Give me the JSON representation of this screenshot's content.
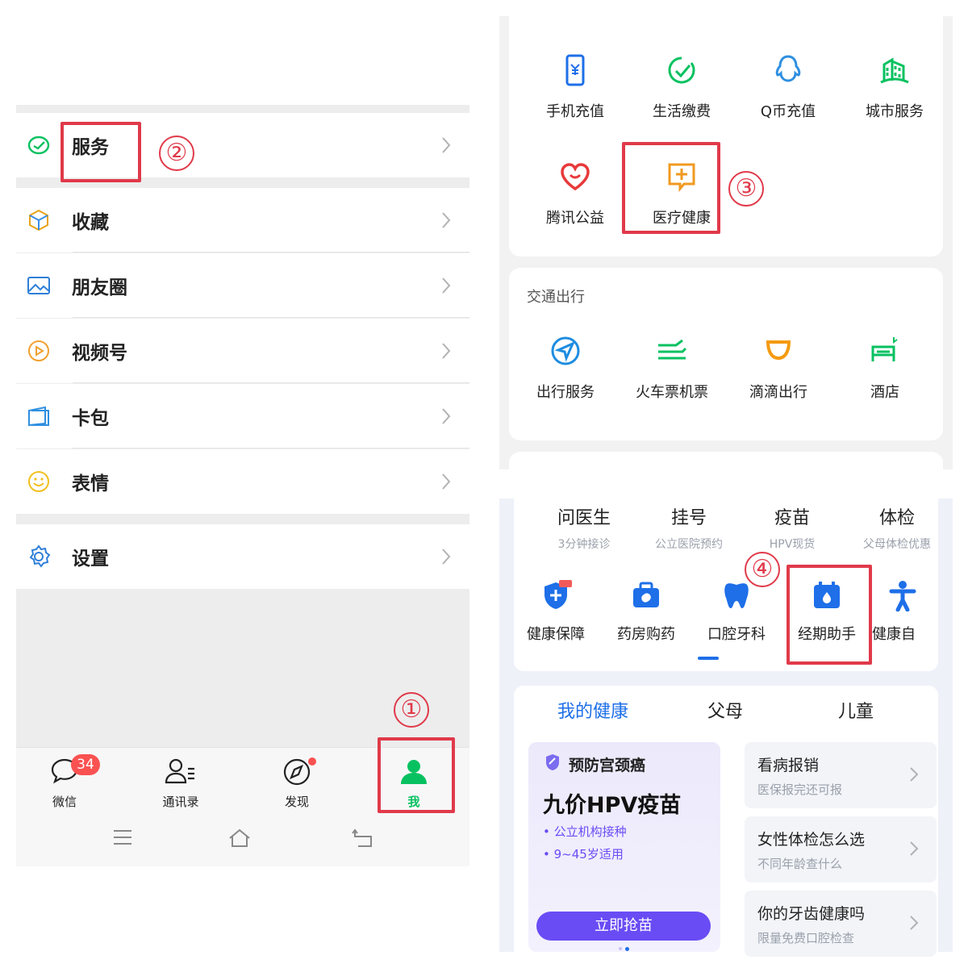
{
  "panelA": {
    "menu": [
      {
        "label": "服务",
        "icon": "service-icon"
      },
      {
        "label": "收藏",
        "icon": "favorites-icon"
      },
      {
        "label": "朋友圈",
        "icon": "moments-icon"
      },
      {
        "label": "视频号",
        "icon": "channels-icon"
      },
      {
        "label": "卡包",
        "icon": "card-wallet-icon"
      },
      {
        "label": "表情",
        "icon": "stickers-icon"
      },
      {
        "label": "设置",
        "icon": "settings-icon"
      }
    ],
    "tabbar": [
      {
        "label": "微信",
        "badge": "34"
      },
      {
        "label": "通讯录"
      },
      {
        "label": "发现"
      },
      {
        "label": "我"
      }
    ],
    "step1": "①",
    "step2": "②"
  },
  "panelB": {
    "services": [
      {
        "label": "手机充值",
        "icon": "phone-recharge-icon"
      },
      {
        "label": "生活缴费",
        "icon": "bill-pay-icon"
      },
      {
        "label": "Q币充值",
        "icon": "qcoin-icon"
      },
      {
        "label": "城市服务",
        "icon": "city-service-icon"
      },
      {
        "label": "腾讯公益",
        "icon": "charity-icon"
      },
      {
        "label": "医疗健康",
        "icon": "medical-icon"
      }
    ],
    "transport_title": "交通出行",
    "transport": [
      {
        "label": "出行服务",
        "icon": "travel-icon"
      },
      {
        "label": "火车票机票",
        "icon": "train-flight-icon"
      },
      {
        "label": "滴滴出行",
        "icon": "didi-icon"
      },
      {
        "label": "酒店",
        "icon": "hotel-icon"
      }
    ],
    "step3": "③"
  },
  "panelC": {
    "nav": [
      {
        "title": "问医生",
        "sub": "3分钟接诊"
      },
      {
        "title": "挂号",
        "sub": "公立医院预约"
      },
      {
        "title": "疫苗",
        "sub": "HPV现货"
      },
      {
        "title": "体检",
        "sub": "父母体检优惠"
      }
    ],
    "funcs": [
      {
        "label": "健康保障",
        "icon": "health-shield-icon"
      },
      {
        "label": "药房购药",
        "icon": "pharmacy-icon"
      },
      {
        "label": "口腔牙科",
        "icon": "tooth-icon"
      },
      {
        "label": "经期助手",
        "icon": "period-calendar-icon"
      },
      {
        "label": "健康自",
        "icon": "fitness-person-icon"
      }
    ],
    "tabs": [
      "我的健康",
      "父母",
      "儿童"
    ],
    "promo": {
      "tag": "预防宫颈癌",
      "title": "九价HPV疫苗",
      "b1": "公立机构接种",
      "b2": "9~45岁适用",
      "btn": "立即抢苗"
    },
    "recs": [
      {
        "title": "看病报销",
        "sub": "医保报完还可报"
      },
      {
        "title": "女性体检怎么选",
        "sub": "不同年龄查什么"
      },
      {
        "title": "你的牙齿健康吗",
        "sub": "限量免费口腔检查"
      }
    ],
    "step4": "④"
  },
  "colors": {
    "wechat_green": "#07c160",
    "annotation_red": "#e03a4a",
    "health_blue": "#1e6fe8",
    "promo_purple": "#6a4cf5"
  }
}
